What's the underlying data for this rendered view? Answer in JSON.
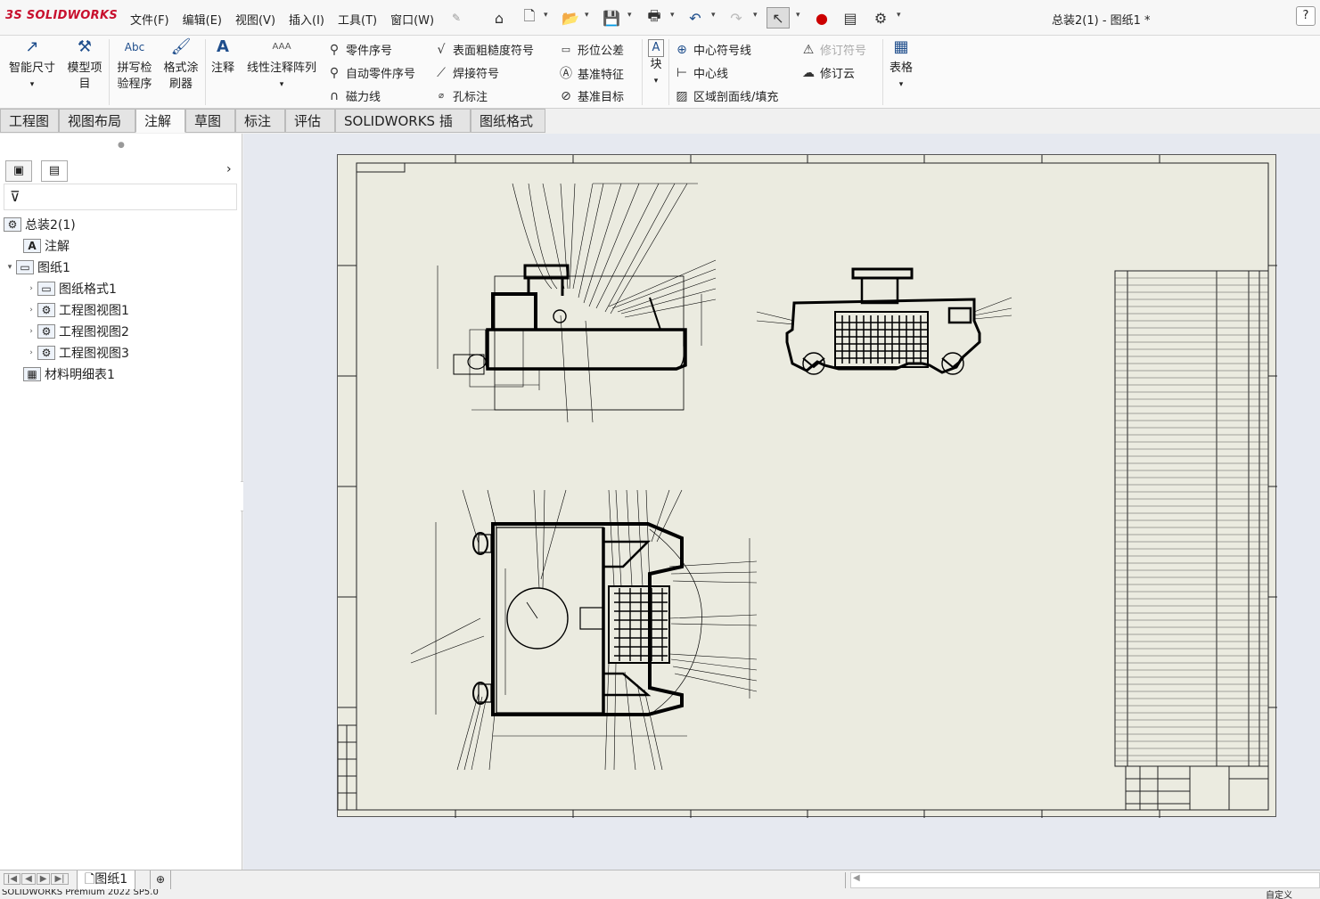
{
  "app": {
    "logo_ds": "3S",
    "logo_text": "SOLIDWORKS",
    "doc_title": "总装2(1) - 图纸1 *",
    "help": "?"
  },
  "menu": [
    "文件(F)",
    "编辑(E)",
    "视图(V)",
    "插入(I)",
    "工具(T)",
    "窗口(W)"
  ],
  "ribbon": {
    "smart_dim": "智能尺寸",
    "model_items_1": "模型项",
    "model_items_2": "目",
    "spell_1": "拼写检",
    "spell_2": "验程序",
    "format_1": "格式涂",
    "format_2": "刷器",
    "note": "注释",
    "linear_note": "线性注释阵列",
    "balloon": "零件序号",
    "auto_balloon": "自动零件序号",
    "magnetic_line": "磁力线",
    "surface_finish": "表面粗糙度符号",
    "weld": "焊接符号",
    "hole_callout": "孔标注",
    "gtol": "形位公差",
    "datum_feature": "基准特征",
    "datum_target": "基准目标",
    "block": "块",
    "center_mark": "中心符号线",
    "centerline": "中心线",
    "hatch": "区域剖面线/填充",
    "rev_symbol": "修订符号",
    "rev_cloud": "修订云",
    "table": "表格"
  },
  "tabs": [
    "工程图",
    "视图布局",
    "注解",
    "草图",
    "标注",
    "评估",
    "SOLIDWORKS 插件",
    "图纸格式"
  ],
  "active_tab": "注解",
  "tree": {
    "root": "总装2(1)",
    "annotations": "注解",
    "sheet": "图纸1",
    "sheet_format": "图纸格式1",
    "view1": "工程图视图1",
    "view2": "工程图视图2",
    "view3": "工程图视图3",
    "bom": "材料明细表1"
  },
  "sheet_tab": "图纸1",
  "status": {
    "left": "SOLIDWORKS Premium 2022 SP5.0",
    "right": "自定义"
  },
  "colors": {
    "accent": "#1f4e8c",
    "sheet": "#ebebe0",
    "canvas": "#e6e9f0",
    "logo": "#c8102e"
  }
}
